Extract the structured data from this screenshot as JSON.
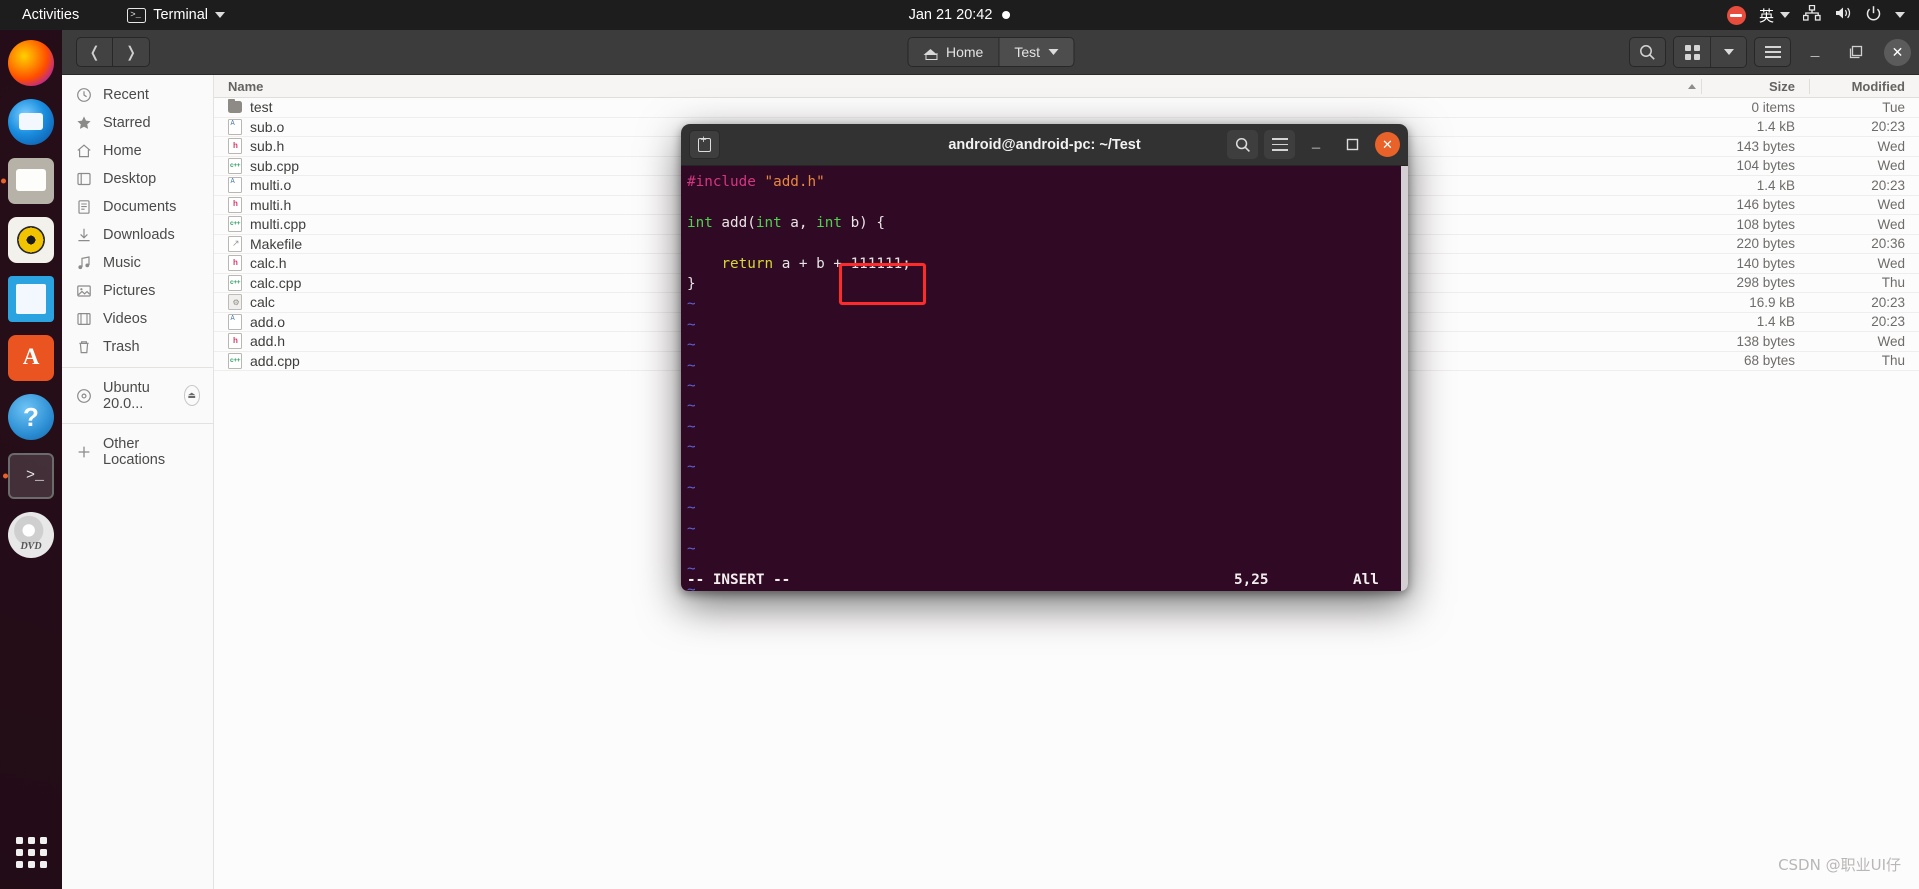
{
  "topbar": {
    "activities": "Activities",
    "app_name": "Terminal",
    "clock": "Jan 21  20:42",
    "ime": "英"
  },
  "dock": {
    "items": [
      {
        "name": "firefox",
        "label": "Firefox"
      },
      {
        "name": "thunderbird",
        "label": "Thunderbird Mail"
      },
      {
        "name": "files",
        "label": "Files"
      },
      {
        "name": "rhythmbox",
        "label": "Rhythmbox"
      },
      {
        "name": "libreoffice-writer",
        "label": "LibreOffice Writer"
      },
      {
        "name": "ubuntu-software",
        "label": "Ubuntu Software"
      },
      {
        "name": "help",
        "label": "Help"
      },
      {
        "name": "terminal",
        "label": "Terminal"
      },
      {
        "name": "dvd",
        "label": "Ubuntu 20.0..."
      }
    ],
    "show_apps": "Show Applications"
  },
  "nautilus": {
    "breadcrumb": [
      {
        "label": "Home",
        "icon": "home-icon"
      },
      {
        "label": "Test",
        "icon": "chevron-down-icon"
      }
    ],
    "sidebar": [
      {
        "label": "Recent",
        "icon": "clock-icon"
      },
      {
        "label": "Starred",
        "icon": "star-icon"
      },
      {
        "label": "Home",
        "icon": "home-icon"
      },
      {
        "label": "Desktop",
        "icon": "desktop-icon"
      },
      {
        "label": "Documents",
        "icon": "documents-icon"
      },
      {
        "label": "Downloads",
        "icon": "download-icon"
      },
      {
        "label": "Music",
        "icon": "music-note-icon"
      },
      {
        "label": "Pictures",
        "icon": "picture-icon"
      },
      {
        "label": "Videos",
        "icon": "film-icon"
      },
      {
        "label": "Trash",
        "icon": "trash-icon"
      }
    ],
    "devices": [
      {
        "label": "Ubuntu 20.0...",
        "icon": "disc-icon",
        "eject": "⏏"
      }
    ],
    "other": {
      "label": "Other Locations",
      "icon": "plus-icon"
    },
    "columns": {
      "name": "Name",
      "size": "Size",
      "modified": "Modified"
    },
    "files": [
      {
        "name": "test",
        "icon": "folder",
        "size": "0 items",
        "modified": "Tue"
      },
      {
        "name": "sub.o",
        "icon": "doc",
        "size": "1.4 kB",
        "modified": "20:23"
      },
      {
        "name": "sub.h",
        "icon": "h",
        "size": "143 bytes",
        "modified": "Wed"
      },
      {
        "name": "sub.cpp",
        "icon": "cpp",
        "size": "104 bytes",
        "modified": "Wed"
      },
      {
        "name": "multi.o",
        "icon": "doc",
        "size": "1.4 kB",
        "modified": "20:23"
      },
      {
        "name": "multi.h",
        "icon": "h",
        "size": "146 bytes",
        "modified": "Wed"
      },
      {
        "name": "multi.cpp",
        "icon": "cpp",
        "size": "108 bytes",
        "modified": "Wed"
      },
      {
        "name": "Makefile",
        "icon": "make",
        "size": "220 bytes",
        "modified": "20:36"
      },
      {
        "name": "calc.h",
        "icon": "h",
        "size": "140 bytes",
        "modified": "Wed"
      },
      {
        "name": "calc.cpp",
        "icon": "cpp",
        "size": "298 bytes",
        "modified": "Thu"
      },
      {
        "name": "calc",
        "icon": "exec",
        "size": "16.9 kB",
        "modified": "20:23"
      },
      {
        "name": "add.o",
        "icon": "doc",
        "size": "1.4 kB",
        "modified": "20:23"
      },
      {
        "name": "add.h",
        "icon": "h",
        "size": "138 bytes",
        "modified": "Wed"
      },
      {
        "name": "add.cpp",
        "icon": "cpp",
        "size": "68 bytes",
        "modified": "Thu"
      }
    ]
  },
  "terminal": {
    "title": "android@android-pc: ~/Test",
    "code_lines": [
      {
        "type": "code",
        "tokens": [
          {
            "t": "#include",
            "c": "kw-pre"
          },
          {
            "t": " ",
            "c": "plain"
          },
          {
            "t": "\"add.h\"",
            "c": "kw-str"
          }
        ]
      },
      {
        "type": "blank",
        "tokens": []
      },
      {
        "type": "code",
        "tokens": [
          {
            "t": "int",
            "c": "kw-type"
          },
          {
            "t": " add(",
            "c": "plain"
          },
          {
            "t": "int",
            "c": "kw-type"
          },
          {
            "t": " a, ",
            "c": "plain"
          },
          {
            "t": "int",
            "c": "kw-type"
          },
          {
            "t": " b) {",
            "c": "plain"
          }
        ]
      },
      {
        "type": "blank",
        "tokens": []
      },
      {
        "type": "code",
        "tokens": [
          {
            "t": "    ",
            "c": "plain"
          },
          {
            "t": "return",
            "c": "kw-ret"
          },
          {
            "t": " a + b + ",
            "c": "plain"
          },
          {
            "t": "111111;",
            "c": "plain"
          }
        ]
      },
      {
        "type": "code",
        "tokens": [
          {
            "t": "}",
            "c": "plain"
          }
        ]
      }
    ],
    "tilde_count": 17,
    "tilde_char": "~",
    "status": {
      "mode": "-- INSERT --",
      "position": "5,25",
      "scroll": "All"
    },
    "annotation_color": "#fd2b2b"
  },
  "watermark": "CSDN @职业UI仔"
}
